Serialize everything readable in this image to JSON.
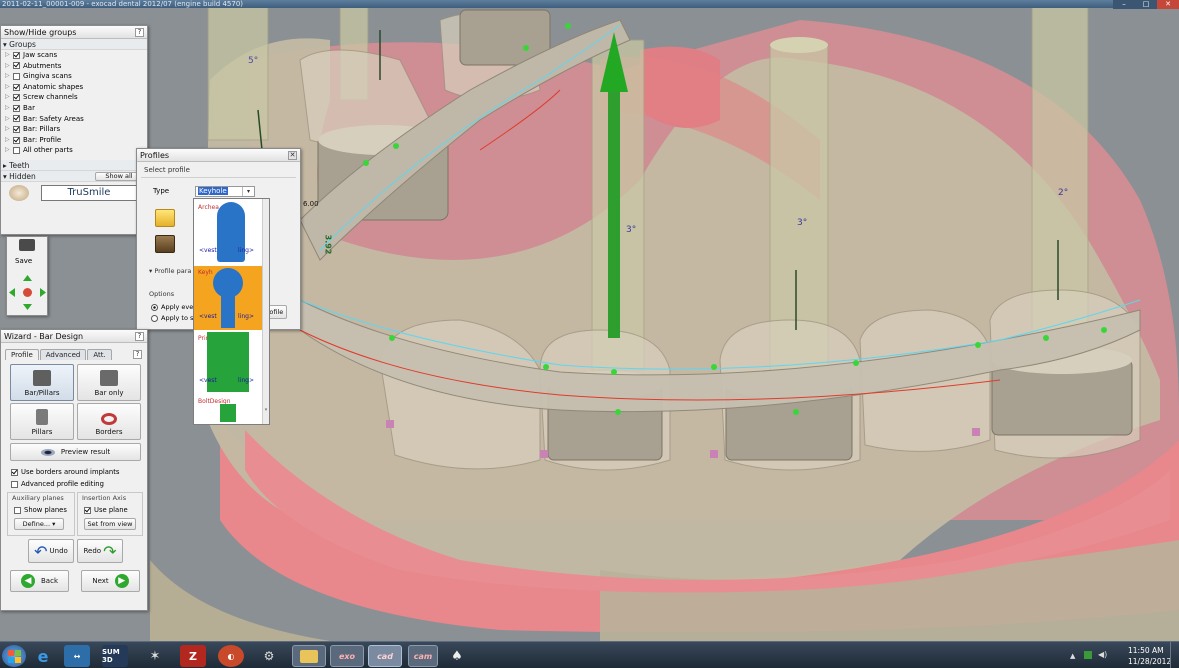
{
  "window": {
    "title": "2011-02-11_00001-009 - exocad dental 2012/07 (engine build 4570)"
  },
  "viewport": {
    "angles": [
      "5°",
      "3°",
      "3°",
      "2°"
    ],
    "measure_a": "6.00",
    "measure_b": "3.92"
  },
  "show_hide": {
    "title": "Show/Hide groups",
    "help": "?",
    "groups_label": "Groups",
    "groups": [
      {
        "label": "Jaw scans",
        "checked": true
      },
      {
        "label": "Abutments",
        "checked": true
      },
      {
        "label": "Gingiva scans",
        "checked": false
      },
      {
        "label": "Anatomic shapes",
        "checked": true
      },
      {
        "label": "Screw channels",
        "checked": true
      },
      {
        "label": "Bar",
        "checked": true
      },
      {
        "label": "Bar: Safety Areas",
        "checked": true
      },
      {
        "label": "Bar: Pillars",
        "checked": true
      },
      {
        "label": "Bar: Profile",
        "checked": true
      },
      {
        "label": "All other parts",
        "checked": false
      }
    ],
    "teeth_label": "Teeth",
    "hidden_label": "Hidden",
    "show_all": "Show all",
    "trusmile": "TruSmile"
  },
  "nav": {
    "save": "Save"
  },
  "profiles": {
    "title": "Profiles",
    "select_profile": "Select profile",
    "type_label": "Type",
    "type_value": "Keyhole",
    "profile_params": "Profile para",
    "options_label": "Options",
    "apply_every": "Apply ever",
    "apply_selected": "Apply to se",
    "profile_btn": "profile",
    "list": [
      {
        "name": "Archea",
        "vest": "<vest",
        "ling": "ling>"
      },
      {
        "name": "Keyh",
        "vest": "<vest",
        "ling": "ling>"
      },
      {
        "name": "PrimaryBar",
        "vest": "<vest",
        "ling": "ling>"
      },
      {
        "name": "BoltDesign",
        "vest": "",
        "ling": ""
      }
    ]
  },
  "wizard": {
    "title": "Wizard - Bar Design",
    "help": "?",
    "tabs": [
      "Profile",
      "Advanced",
      "Att."
    ],
    "buttons": [
      "Bar/Pillars",
      "Bar only",
      "Pillars",
      "Borders"
    ],
    "preview": "Preview result",
    "use_borders": "Use borders around implants",
    "adv_profile": "Advanced profile editing",
    "aux_planes": "Auxiliary planes",
    "insertion_axis": "Insertion Axis",
    "show_planes": "Show planes",
    "use_plane": "Use plane",
    "define": "Define...",
    "set_from_view": "Set from view",
    "undo": "Undo",
    "redo": "Redo",
    "back": "Back",
    "next": "Next"
  },
  "taskbar": {
    "apps": [
      "SUM 3D",
      "exo",
      "cad",
      "cam"
    ],
    "time": "11:50 AM",
    "date": "11/28/2012"
  }
}
